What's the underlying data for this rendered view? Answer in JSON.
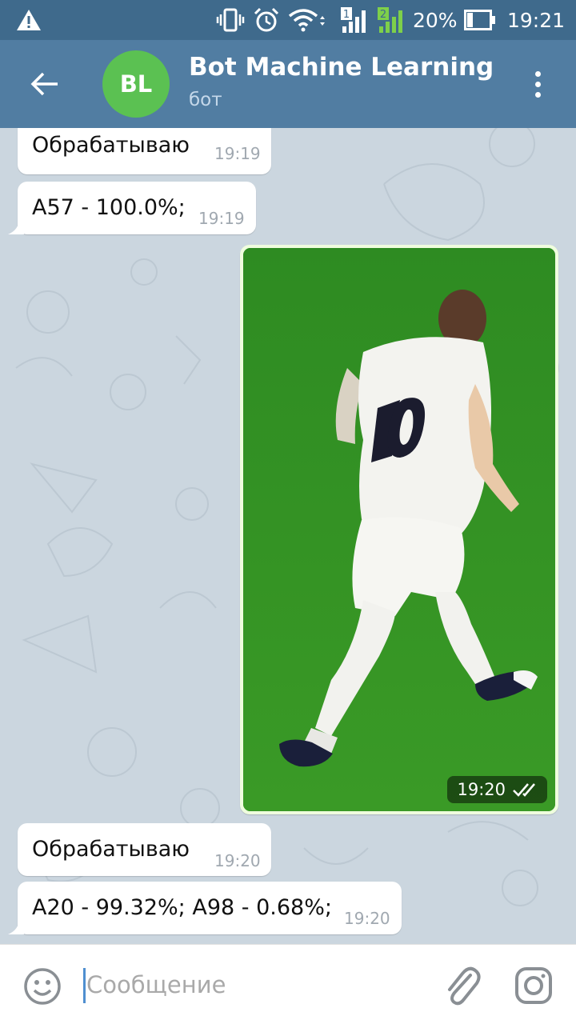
{
  "status_bar": {
    "battery": "20%",
    "time": "19:21",
    "sim1_label": "1",
    "sim2_label": "2",
    "icons": [
      "warning-icon",
      "vibrate-icon",
      "alarm-icon",
      "wifi-icon",
      "signal-icon",
      "battery-icon"
    ]
  },
  "header": {
    "avatar_initials": "BL",
    "title": "Bot Machine Learning",
    "subtitle": "бот",
    "avatar_color": "#5bc152",
    "bar_color": "#517da2"
  },
  "messages": [
    {
      "type": "incoming",
      "text": "Обрабатываю",
      "time": "19:19"
    },
    {
      "type": "incoming",
      "text": "A57 - 100.0%;",
      "time": "19:19"
    },
    {
      "type": "outgoing-photo",
      "time": "19:20",
      "status": "read"
    },
    {
      "type": "incoming",
      "text": "Обрабатываю",
      "time": "19:20"
    },
    {
      "type": "incoming",
      "text": "A20 - 99.32%; A98 - 0.68%;",
      "time": "19:20"
    }
  ],
  "input": {
    "placeholder": "Сообщение"
  }
}
